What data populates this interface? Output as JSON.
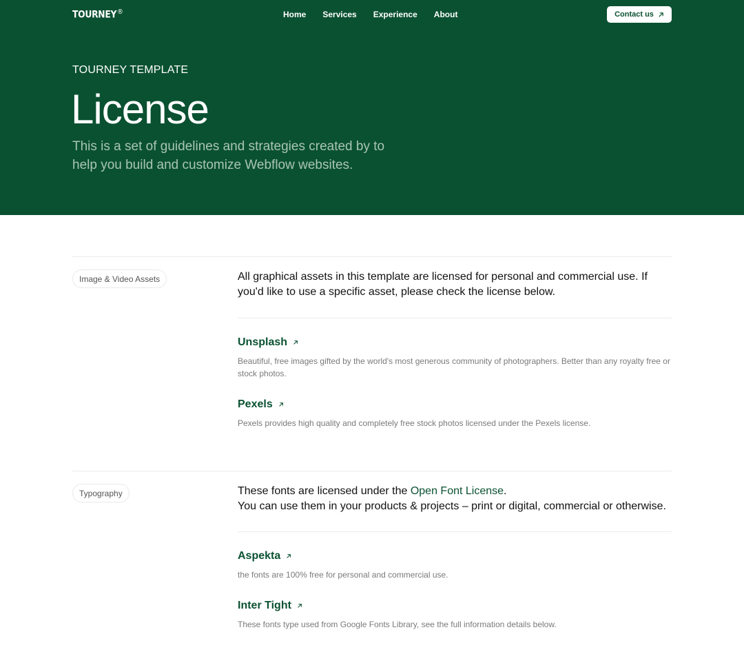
{
  "header": {
    "logo": "TOURNEY",
    "logo_mark": "®",
    "nav": [
      "Home",
      "Services",
      "Experience",
      "About"
    ],
    "contact_label": "Contact us"
  },
  "hero": {
    "eyebrow": "TOURNEY TEMPLATE",
    "title": "License",
    "subtitle": "This is a set of guidelines and strategies created by to help you build and customize Webflow websites."
  },
  "sections": [
    {
      "tag": "Image & Video Assets",
      "intro": "All graphical assets in this template are licensed for personal and commercial use. If you'd like to use a specific asset, please check the license below.",
      "items": [
        {
          "title": "Unsplash",
          "desc": "Beautiful, free images gifted by the world's most generous community of photographers. Better than any royalty free or stock photos."
        },
        {
          "title": "Pexels",
          "desc": "Pexels provides high quality and completely free stock photos licensed under the Pexels license."
        }
      ]
    },
    {
      "tag": "Typography",
      "intro_before": "These fonts are licensed under the ",
      "intro_link": "Open Font License",
      "intro_after": ".",
      "intro_line2": "You can use them in your products & projects – print or digital, commercial or otherwise.",
      "items": [
        {
          "title": "Aspekta",
          "desc": "the fonts are 100% free for personal and commercial use."
        },
        {
          "title": "Inter Tight",
          "desc": "These fonts type used from Google Fonts Library, see the full information details below."
        }
      ]
    }
  ],
  "colors": {
    "brand": "#0a5131",
    "hero_sub": "#a9c5b4",
    "muted": "#7a7a7a"
  },
  "icons": {
    "external": "arrow-up-right-icon"
  }
}
